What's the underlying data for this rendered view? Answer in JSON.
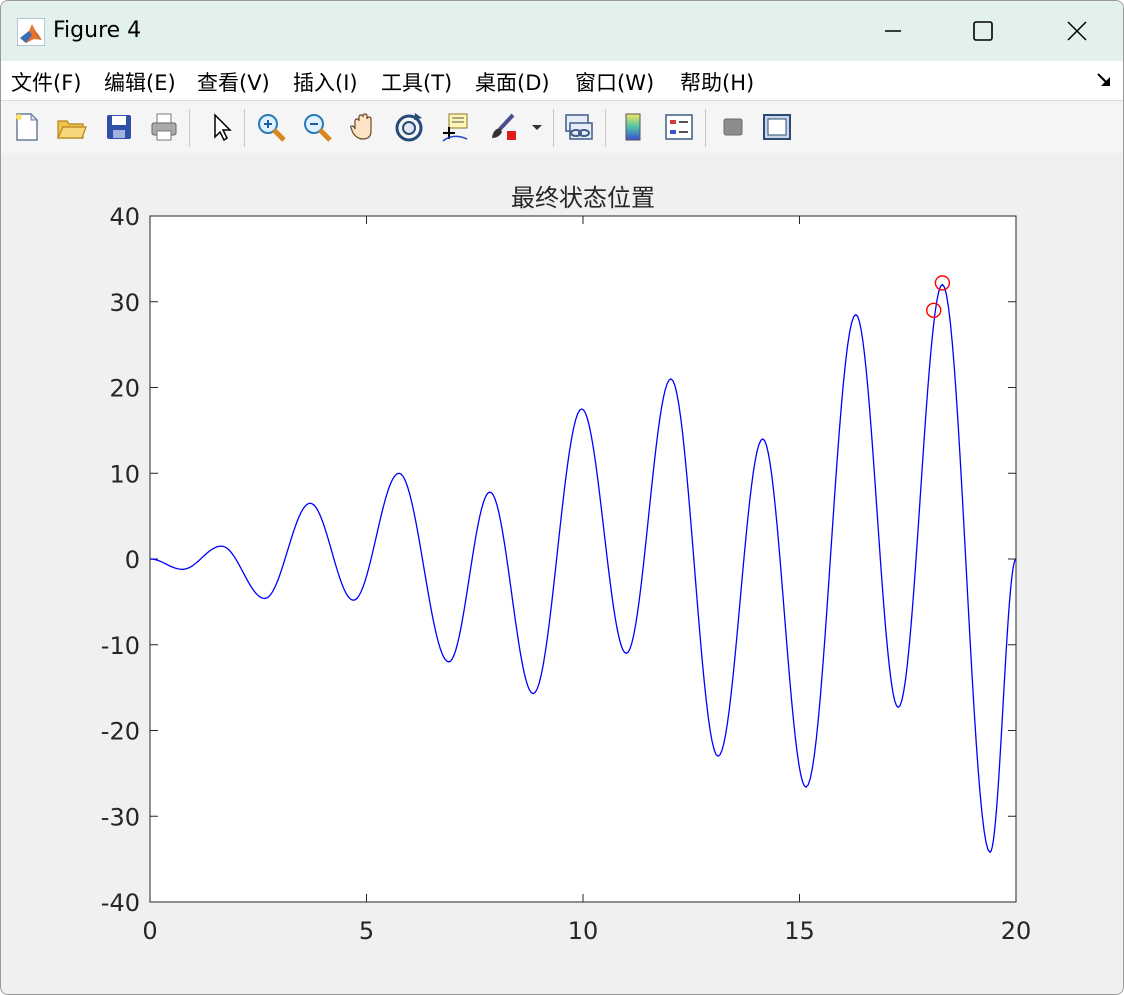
{
  "window": {
    "title": "Figure 4",
    "controls": {
      "minimize": "minimize",
      "maximize": "maximize",
      "close": "close"
    }
  },
  "menubar": {
    "items": [
      {
        "label": "文件(F)"
      },
      {
        "label": "编辑(E)"
      },
      {
        "label": "查看(V)"
      },
      {
        "label": "插入(I)"
      },
      {
        "label": "工具(T)"
      },
      {
        "label": "桌面(D)"
      },
      {
        "label": "窗口(W)"
      },
      {
        "label": "帮助(H)"
      }
    ]
  },
  "toolbar": {
    "buttons": [
      "new-figure-icon",
      "open-file-icon",
      "save-icon",
      "print-icon",
      "pointer-icon",
      "zoom-in-icon",
      "zoom-out-icon",
      "pan-hand-icon",
      "rotate-3d-icon",
      "data-cursor-icon",
      "brush-icon",
      "brush-dropdown-icon",
      "link-plot-icon",
      "colorbar-icon",
      "legend-icon",
      "hide-plot-tools-icon",
      "show-plot-tools-icon"
    ]
  },
  "chart_data": {
    "type": "line",
    "title": "最终状态位置",
    "xlabel": "",
    "ylabel": "",
    "xlim": [
      0,
      20
    ],
    "ylim": [
      -40,
      40
    ],
    "xticks": [
      "0",
      "5",
      "10",
      "15",
      "20"
    ],
    "yticks": [
      "-40",
      "-30",
      "-20",
      "-10",
      "0",
      "10",
      "20",
      "30",
      "40"
    ],
    "grid": false,
    "line_color": "#0000ff",
    "marker_color": "#ff0000",
    "series": [
      {
        "x": [
          0,
          0.75,
          1.65,
          2.65,
          3.7,
          4.7,
          5.75,
          6.9,
          7.85,
          8.85,
          9.97,
          11.0,
          12.03,
          13.12,
          14.15,
          15.15,
          16.3,
          17.28,
          18.3,
          19.4,
          20.0
        ],
        "y": [
          0,
          -1.2,
          1.5,
          -4.6,
          6.5,
          -4.8,
          10.0,
          -12.0,
          7.8,
          -15.7,
          17.5,
          -11.0,
          21.0,
          -23.0,
          14.0,
          -26.6,
          28.5,
          -17.3,
          32.0,
          -34.2,
          0
        ]
      }
    ],
    "markers": [
      {
        "x": 18.1,
        "y": 29.0
      },
      {
        "x": 18.3,
        "y": 32.2
      }
    ]
  }
}
